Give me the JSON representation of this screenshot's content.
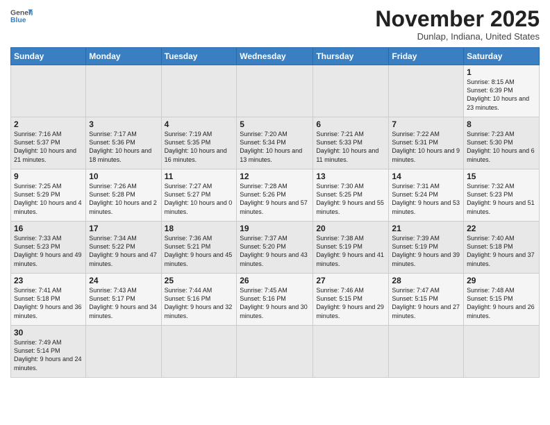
{
  "header": {
    "logo_general": "General",
    "logo_blue": "Blue",
    "title": "November 2025",
    "location": "Dunlap, Indiana, United States"
  },
  "weekdays": [
    "Sunday",
    "Monday",
    "Tuesday",
    "Wednesday",
    "Thursday",
    "Friday",
    "Saturday"
  ],
  "weeks": [
    [
      {
        "day": "",
        "info": ""
      },
      {
        "day": "",
        "info": ""
      },
      {
        "day": "",
        "info": ""
      },
      {
        "day": "",
        "info": ""
      },
      {
        "day": "",
        "info": ""
      },
      {
        "day": "",
        "info": ""
      },
      {
        "day": "1",
        "info": "Sunrise: 8:15 AM\nSunset: 6:39 PM\nDaylight: 10 hours and 23 minutes."
      }
    ],
    [
      {
        "day": "2",
        "info": "Sunrise: 7:16 AM\nSunset: 5:37 PM\nDaylight: 10 hours and 21 minutes."
      },
      {
        "day": "3",
        "info": "Sunrise: 7:17 AM\nSunset: 5:36 PM\nDaylight: 10 hours and 18 minutes."
      },
      {
        "day": "4",
        "info": "Sunrise: 7:19 AM\nSunset: 5:35 PM\nDaylight: 10 hours and 16 minutes."
      },
      {
        "day": "5",
        "info": "Sunrise: 7:20 AM\nSunset: 5:34 PM\nDaylight: 10 hours and 13 minutes."
      },
      {
        "day": "6",
        "info": "Sunrise: 7:21 AM\nSunset: 5:33 PM\nDaylight: 10 hours and 11 minutes."
      },
      {
        "day": "7",
        "info": "Sunrise: 7:22 AM\nSunset: 5:31 PM\nDaylight: 10 hours and 9 minutes."
      },
      {
        "day": "8",
        "info": "Sunrise: 7:23 AM\nSunset: 5:30 PM\nDaylight: 10 hours and 6 minutes."
      }
    ],
    [
      {
        "day": "9",
        "info": "Sunrise: 7:25 AM\nSunset: 5:29 PM\nDaylight: 10 hours and 4 minutes."
      },
      {
        "day": "10",
        "info": "Sunrise: 7:26 AM\nSunset: 5:28 PM\nDaylight: 10 hours and 2 minutes."
      },
      {
        "day": "11",
        "info": "Sunrise: 7:27 AM\nSunset: 5:27 PM\nDaylight: 10 hours and 0 minutes."
      },
      {
        "day": "12",
        "info": "Sunrise: 7:28 AM\nSunset: 5:26 PM\nDaylight: 9 hours and 57 minutes."
      },
      {
        "day": "13",
        "info": "Sunrise: 7:30 AM\nSunset: 5:25 PM\nDaylight: 9 hours and 55 minutes."
      },
      {
        "day": "14",
        "info": "Sunrise: 7:31 AM\nSunset: 5:24 PM\nDaylight: 9 hours and 53 minutes."
      },
      {
        "day": "15",
        "info": "Sunrise: 7:32 AM\nSunset: 5:23 PM\nDaylight: 9 hours and 51 minutes."
      }
    ],
    [
      {
        "day": "16",
        "info": "Sunrise: 7:33 AM\nSunset: 5:23 PM\nDaylight: 9 hours and 49 minutes."
      },
      {
        "day": "17",
        "info": "Sunrise: 7:34 AM\nSunset: 5:22 PM\nDaylight: 9 hours and 47 minutes."
      },
      {
        "day": "18",
        "info": "Sunrise: 7:36 AM\nSunset: 5:21 PM\nDaylight: 9 hours and 45 minutes."
      },
      {
        "day": "19",
        "info": "Sunrise: 7:37 AM\nSunset: 5:20 PM\nDaylight: 9 hours and 43 minutes."
      },
      {
        "day": "20",
        "info": "Sunrise: 7:38 AM\nSunset: 5:19 PM\nDaylight: 9 hours and 41 minutes."
      },
      {
        "day": "21",
        "info": "Sunrise: 7:39 AM\nSunset: 5:19 PM\nDaylight: 9 hours and 39 minutes."
      },
      {
        "day": "22",
        "info": "Sunrise: 7:40 AM\nSunset: 5:18 PM\nDaylight: 9 hours and 37 minutes."
      }
    ],
    [
      {
        "day": "23",
        "info": "Sunrise: 7:41 AM\nSunset: 5:18 PM\nDaylight: 9 hours and 36 minutes."
      },
      {
        "day": "24",
        "info": "Sunrise: 7:43 AM\nSunset: 5:17 PM\nDaylight: 9 hours and 34 minutes."
      },
      {
        "day": "25",
        "info": "Sunrise: 7:44 AM\nSunset: 5:16 PM\nDaylight: 9 hours and 32 minutes."
      },
      {
        "day": "26",
        "info": "Sunrise: 7:45 AM\nSunset: 5:16 PM\nDaylight: 9 hours and 30 minutes."
      },
      {
        "day": "27",
        "info": "Sunrise: 7:46 AM\nSunset: 5:15 PM\nDaylight: 9 hours and 29 minutes."
      },
      {
        "day": "28",
        "info": "Sunrise: 7:47 AM\nSunset: 5:15 PM\nDaylight: 9 hours and 27 minutes."
      },
      {
        "day": "29",
        "info": "Sunrise: 7:48 AM\nSunset: 5:15 PM\nDaylight: 9 hours and 26 minutes."
      }
    ],
    [
      {
        "day": "30",
        "info": "Sunrise: 7:49 AM\nSunset: 5:14 PM\nDaylight: 9 hours and 24 minutes."
      },
      {
        "day": "",
        "info": ""
      },
      {
        "day": "",
        "info": ""
      },
      {
        "day": "",
        "info": ""
      },
      {
        "day": "",
        "info": ""
      },
      {
        "day": "",
        "info": ""
      },
      {
        "day": "",
        "info": ""
      }
    ]
  ]
}
